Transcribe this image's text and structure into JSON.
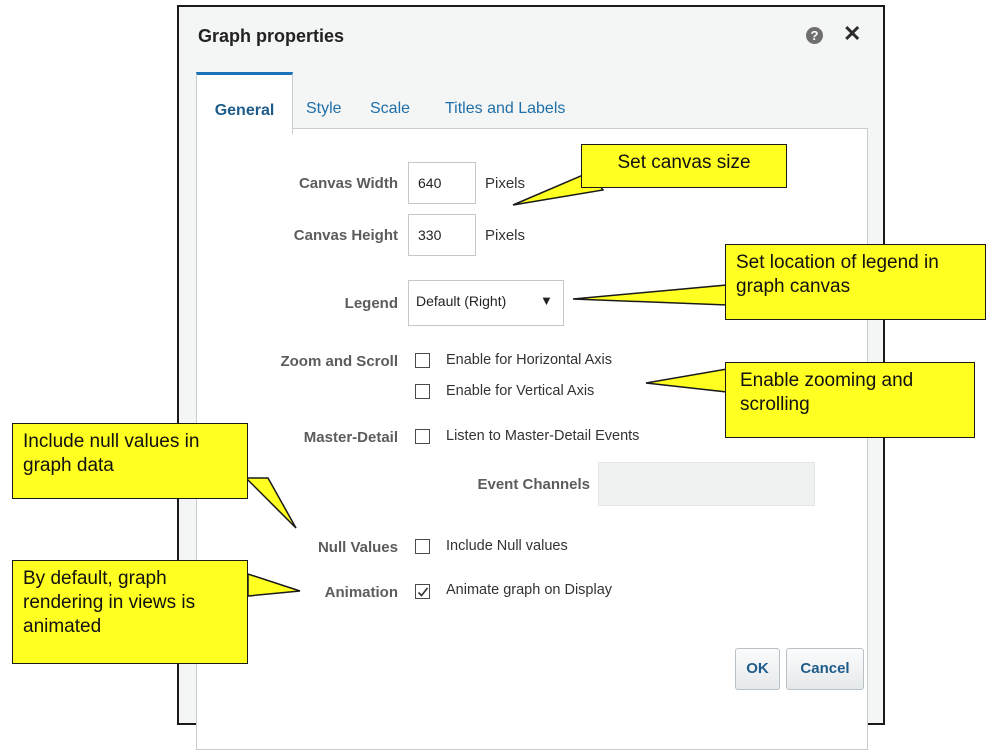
{
  "dialog": {
    "title": "Graph properties",
    "help_icon": "?",
    "close_icon": "✕",
    "tabs": [
      "General",
      "Style",
      "Scale",
      "Titles and Labels"
    ],
    "active_tab": "General"
  },
  "form": {
    "canvas_width": {
      "label": "Canvas Width",
      "value": "640",
      "unit": "Pixels"
    },
    "canvas_height": {
      "label": "Canvas Height",
      "value": "330",
      "unit": "Pixels"
    },
    "legend": {
      "label": "Legend",
      "value": "Default (Right)",
      "arrow": "▼"
    },
    "zoom_scroll": {
      "label": "Zoom and Scroll",
      "horizontal": {
        "text": "Enable for Horizontal Axis",
        "checked": false
      },
      "vertical": {
        "text": "Enable for Vertical Axis",
        "checked": false
      }
    },
    "master_detail": {
      "label": "Master-Detail",
      "listen": {
        "text": "Listen to Master-Detail Events",
        "checked": false
      },
      "event_channels_label": "Event Channels",
      "event_channels_value": ""
    },
    "null_values": {
      "label": "Null Values",
      "text": "Include Null values",
      "checked": false
    },
    "animation": {
      "label": "Animation",
      "text": "Animate graph on Display",
      "checked": true
    }
  },
  "buttons": {
    "ok": "OK",
    "cancel": "Cancel"
  },
  "callouts": {
    "canvas_size": "Set canvas size",
    "legend_location": "Set location of legend in graph canvas",
    "zooming": "Enable zooming and scrolling",
    "null_values": "Include null values in graph data",
    "animated": "By default, graph rendering in views is animated"
  },
  "colors": {
    "callout": "#ffff21",
    "link": "#1f6fa8",
    "tab_accent": "#1a73b8"
  }
}
